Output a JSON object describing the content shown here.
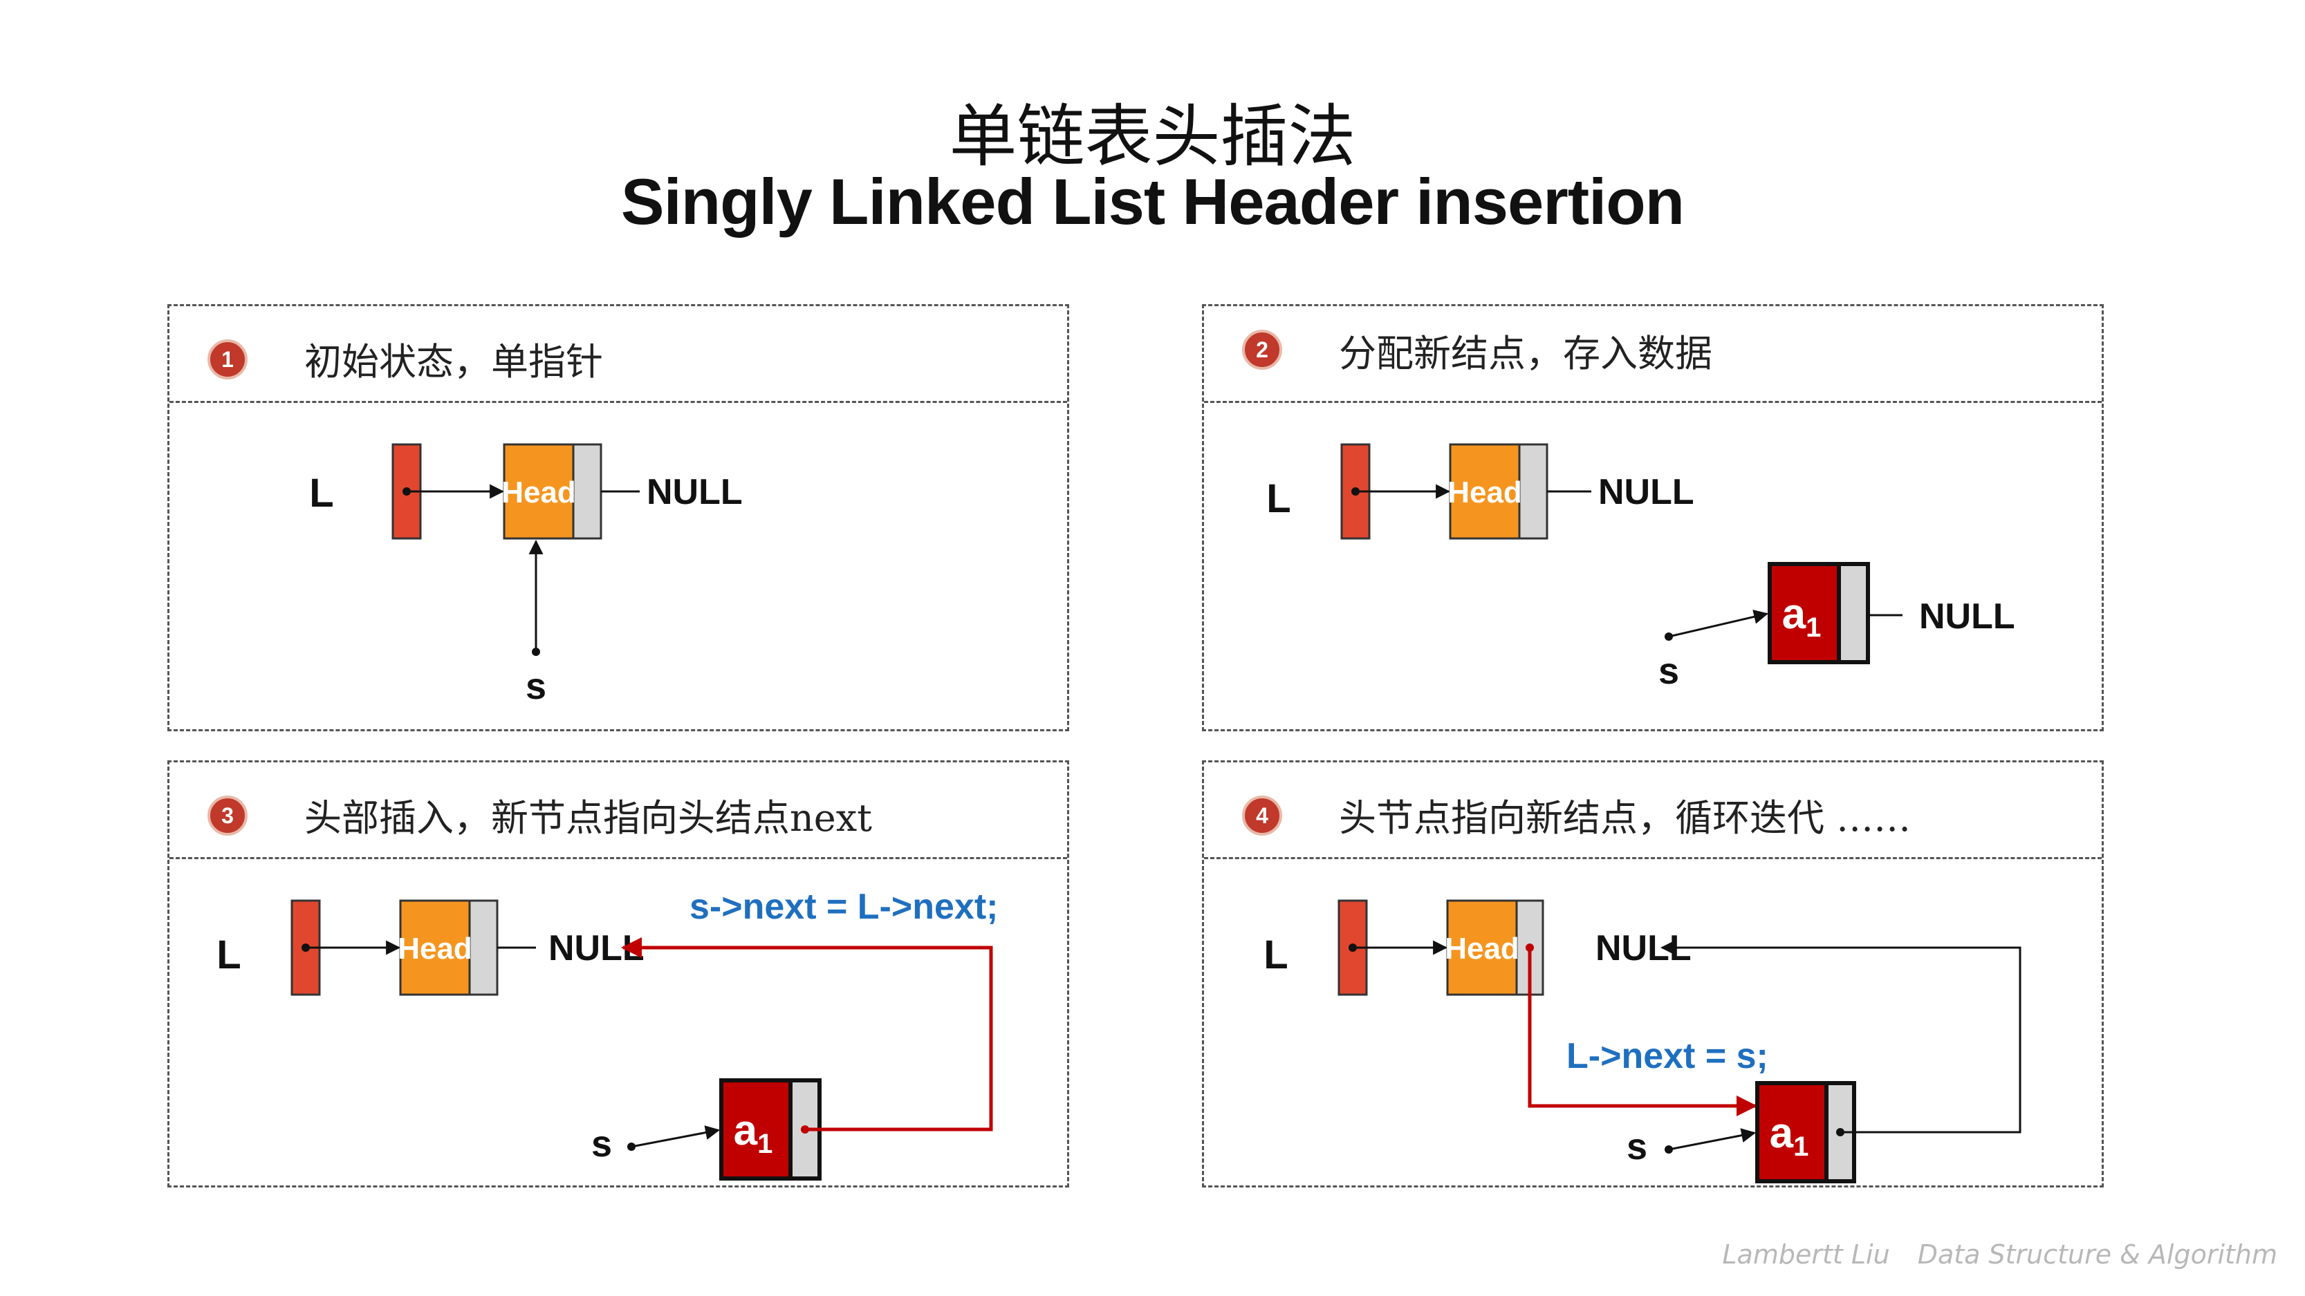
{
  "title": {
    "cn": "单链表头插法",
    "en": "Singly Linked List Header insertion"
  },
  "colors": {
    "pointer_block": "#e0472e",
    "head_node": "#f5951f",
    "node_next": "#d6d6d6",
    "new_node": "#c00000",
    "highlight_arrow": "#c00000",
    "code": "#1f6fbf"
  },
  "steps": [
    {
      "number": "1",
      "text": "初始状态，单指针"
    },
    {
      "number": "2",
      "text": "分配新结点，存入数据"
    },
    {
      "number": "3",
      "text": "头部插入，新节点指向头结点next"
    },
    {
      "number": "4",
      "text": "头节点指向新结点，循环迭代 ……"
    }
  ],
  "labels": {
    "list": "L",
    "head": "Head",
    "null": "NULL",
    "s": "s",
    "node_a": "a",
    "node_sub": "1"
  },
  "code": {
    "step3": "s->next = L->next;",
    "step4": "L->next = s;"
  },
  "footer": {
    "author": "Lambertt Liu",
    "course": "Data Structure & Algorithm"
  }
}
